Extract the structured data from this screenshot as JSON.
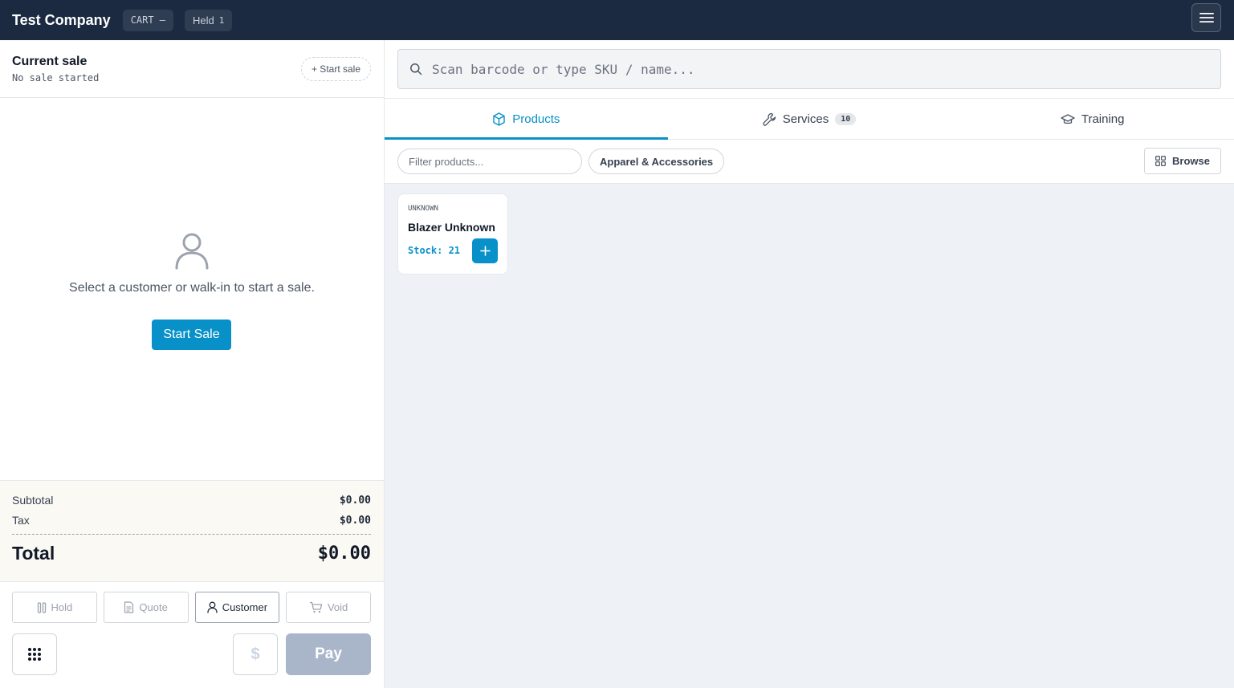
{
  "header": {
    "company": "Test Company",
    "cart_pill": "CART —",
    "held_label": "Held",
    "held_count": "1",
    "menu_icon": "hamburger-icon"
  },
  "sale": {
    "title": "Current sale",
    "subtitle": "No sale started",
    "start_pill": "+ Start sale",
    "empty_icon": "user-icon",
    "empty_text": "Select a customer or walk-in to start a sale.",
    "start_button": "Start Sale"
  },
  "totals": {
    "subtotal_label": "Subtotal",
    "subtotal_value": "$0.00",
    "tax_label": "Tax",
    "tax_value": "$0.00",
    "total_label": "Total",
    "total_value": "$0.00"
  },
  "actions": [
    {
      "label": "Hold",
      "icon": "pause-icon"
    },
    {
      "label": "Quote",
      "icon": "document-icon"
    },
    {
      "label": "Customer",
      "icon": "user-icon"
    },
    {
      "label": "Void",
      "icon": "cart-icon"
    }
  ],
  "footer": {
    "keypad_icon": "keypad-icon",
    "dollar_label": "$",
    "pay_label": "Pay"
  },
  "search": {
    "placeholder": "Scan barcode or type SKU / name..."
  },
  "tabs": [
    {
      "label": "Products",
      "icon": "box-icon",
      "active": true
    },
    {
      "label": "Services",
      "icon": "wrench-icon",
      "badge": "10"
    },
    {
      "label": "Training",
      "icon": "graduation-cap-icon"
    }
  ],
  "filters": {
    "placeholder": "Filter products...",
    "category": "Apparel & Accessories",
    "browse": "Browse"
  },
  "products": [
    {
      "brand": "UNKNOWN",
      "name": "Blazer Unknown",
      "stock": "Stock: 21"
    }
  ],
  "colors": {
    "topbar": "#1b2a41",
    "accent": "#0891c8",
    "pay_disabled": "#a9b6c9",
    "totals_bg": "#faf9f4",
    "grid_bg": "#eef2f7"
  }
}
